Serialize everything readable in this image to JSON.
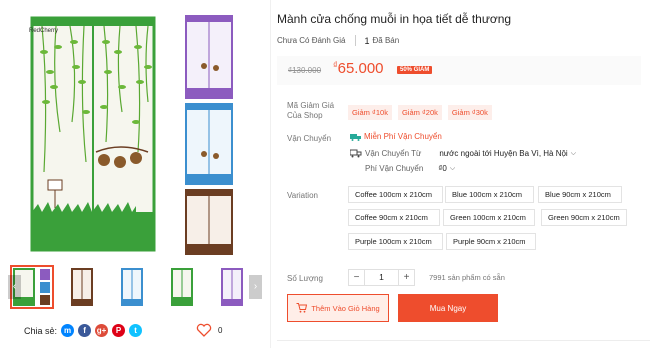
{
  "product": {
    "title": "Mành cửa chống muỗi in họa tiết dễ thương",
    "rating_text": "Chưa Có Đánh Giá",
    "sold_count": "1",
    "sold_label": "Đã Bán"
  },
  "gallery": {
    "watermark": "RedCherry",
    "thumb_colors": [
      "#3aa03a",
      "#6b3d22",
      "#3b8fcf",
      "#3aa03a",
      "#8c5bbf"
    ]
  },
  "price": {
    "old": "₫130.000",
    "currency": "₫",
    "new": "65.000",
    "discount": "50% GIẢM"
  },
  "vouchers": {
    "label": "Mã Giảm Giá Của Shop",
    "items": [
      "Giảm ₫10k",
      "Giảm ₫20k",
      "Giảm ₫30k"
    ]
  },
  "shipping": {
    "label": "Vận Chuyển",
    "free": "Miễn Phí Vận Chuyển",
    "from_label": "Vận Chuyển Từ",
    "from_value": "nước ngoài tới Huyện Ba Vì, Hà Nội",
    "fee_label": "Phí Vận Chuyển",
    "fee_value": "₫0"
  },
  "variation": {
    "label": "Variation",
    "options": [
      "Coffee 100cm x 210cm",
      "Blue 100cm x 210cm",
      "Blue 90cm x 210cm",
      "Coffee 90cm x 210cm",
      "Green 100cm x 210cm",
      "Green 90cm x 210cm",
      "Purple 100cm x 210cm",
      "Purple 90cm x 210cm"
    ]
  },
  "quantity": {
    "label": "Số Lượng",
    "minus": "−",
    "value": "1",
    "plus": "+",
    "stock": "7991 sản phẩm có sẵn"
  },
  "actions": {
    "add_to_cart": "Thêm Vào Giỏ Hàng",
    "buy_now": "Mua Ngay"
  },
  "share": {
    "label": "Chia sẻ:",
    "networks": [
      {
        "name": "messenger",
        "glyph": "m",
        "color": "#0084ff"
      },
      {
        "name": "facebook",
        "glyph": "f",
        "color": "#3b5999"
      },
      {
        "name": "google-plus",
        "glyph": "g+",
        "color": "#dd4b39"
      },
      {
        "name": "pinterest",
        "glyph": "P",
        "color": "#de0217"
      },
      {
        "name": "twitter",
        "glyph": "t",
        "color": "#10c2ff"
      }
    ],
    "likes": "0"
  },
  "colors": {
    "accent": "#ee4d2d",
    "green": "#3aa03a",
    "purple": "#8c5bbf",
    "blue": "#3b8fcf",
    "brown": "#6b3d22"
  }
}
